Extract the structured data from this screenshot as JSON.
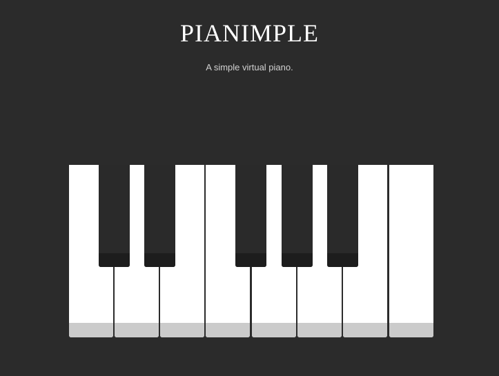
{
  "header": {
    "title": "PIANIMPLE",
    "subtitle": "A simple virtual piano."
  },
  "piano": {
    "white_keys": [
      {
        "note": "C"
      },
      {
        "note": "D"
      },
      {
        "note": "E"
      },
      {
        "note": "F"
      },
      {
        "note": "G"
      },
      {
        "note": "A"
      },
      {
        "note": "B"
      },
      {
        "note": "C"
      }
    ],
    "black_keys": [
      {
        "note": "C#"
      },
      {
        "note": "D#"
      },
      {
        "note": "F#"
      },
      {
        "note": "G#"
      },
      {
        "note": "A#"
      }
    ],
    "colors": {
      "background": "#2b2b2b",
      "white_key": "#ffffff",
      "white_key_shade": "#cbcbcb",
      "black_key": "#2a2a2a",
      "black_key_shade": "#1d1d1d"
    }
  }
}
